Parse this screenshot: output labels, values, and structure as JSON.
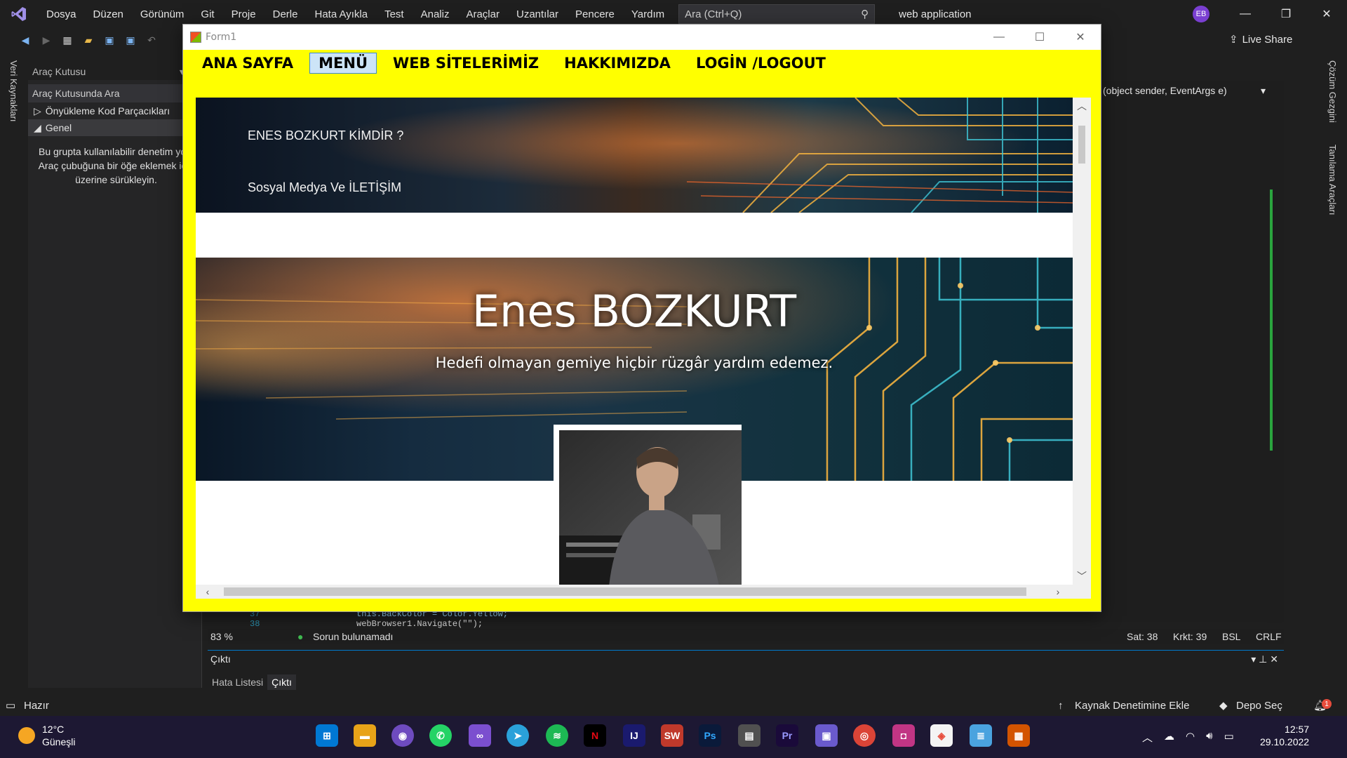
{
  "vs": {
    "menu": [
      "Dosya",
      "Düzen",
      "Görünüm",
      "Git",
      "Proje",
      "Derle",
      "Hata Ayıkla",
      "Test",
      "Analiz",
      "Araçlar",
      "Uzantılar",
      "Pencere",
      "Yardım"
    ],
    "search_placeholder": "Ara (Ctrl+Q)",
    "project_name": "web application",
    "avatar_initials": "EB",
    "live_share": "Live Share",
    "left_vertical_tab": "Veri Kaynakları",
    "right_vertical_tabs": [
      "Çözüm Gezgini",
      "Tanılama Araçları"
    ],
    "toolbox": {
      "title": "Araç Kutusu",
      "search": "Araç Kutusunda Ara",
      "sections": [
        "Önyükleme Kod Parçacıkları",
        "Genel"
      ],
      "empty_text": "Bu grupta kullanılabilir denetim yok. Araç çubuğuna bir öğe eklemek için üzerine sürükleyin."
    },
    "method_dropdown": "(object sender, EventArgs e)",
    "code_lines": [
      {
        "num": "37",
        "text": "this.BackColor = Color.Yellow;"
      },
      {
        "num": "38",
        "text": "webBrowser1.Navigate(\"\");"
      }
    ],
    "editor_status": {
      "zoom": "83 %",
      "issues": "Sorun bulunamadı",
      "line": "Sat: 38",
      "col": "Krkt: 39",
      "ws": "BSL",
      "eol": "CRLF"
    },
    "output": {
      "title": "Çıktı",
      "tabs": [
        "Hata Listesi",
        "Çıktı"
      ]
    },
    "statusbar": {
      "ready": "Hazır",
      "source_control": "Kaynak Denetimine Ekle",
      "repo": "Depo Seç",
      "notif_count": "1"
    }
  },
  "taskbar": {
    "weather_temp": "12°C",
    "weather_desc": "Güneşli",
    "time": "12:57",
    "date": "29.10.2022"
  },
  "form": {
    "title": "Form1",
    "menu": [
      "ANA SAYFA",
      "MENÜ",
      "WEB SİTELERİMİZ",
      "HAKKIMIZDA",
      "LOGİN /LOGOUT"
    ],
    "active_menu_index": 1,
    "hero_links": [
      "ENES BOZKURT KİMDİR ?",
      "Sosyal Medya Ve İLETİŞİM"
    ],
    "hero_name": "Enes BOZKURT",
    "hero_quote": "Hedefi olmayan gemiye hiçbir rüzgâr yardım edemez.",
    "bg_color": "#ffff00"
  }
}
